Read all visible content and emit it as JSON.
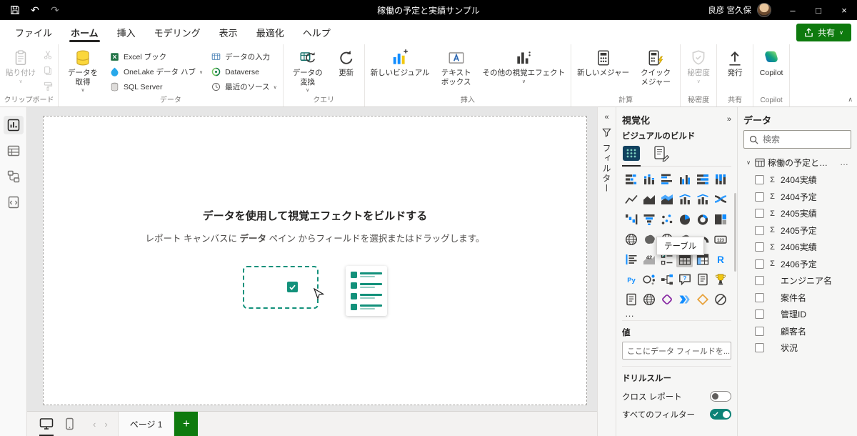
{
  "colors": {
    "accent_green": "#0e7a0e",
    "toggle_on": "#0c8276",
    "icon_blue": "#118DFF",
    "titlebar_bg": "#000000",
    "illustration_green": "#13917b"
  },
  "glyphs": {
    "chevron_down": "∨",
    "chevron_up": "∧",
    "chevron_left_double": "«",
    "chevron_right_double": "»",
    "undo": "↶",
    "redo": "↷",
    "minimize": "–",
    "maximize": "□",
    "close": "×",
    "more": "…",
    "ellipsis_row": "…",
    "page_prev": "‹",
    "page_next": "›",
    "sigma": "Σ",
    "plus": "+"
  },
  "titlebar": {
    "title": "稼働の予定と実績サンプル",
    "user_name": "良彦 宮久保"
  },
  "menubar": {
    "tabs": [
      {
        "name": "file",
        "label": "ファイル"
      },
      {
        "name": "home",
        "label": "ホーム"
      },
      {
        "name": "insert",
        "label": "挿入"
      },
      {
        "name": "modeling",
        "label": "モデリング"
      },
      {
        "name": "view",
        "label": "表示"
      },
      {
        "name": "optimize",
        "label": "最適化"
      },
      {
        "name": "help",
        "label": "ヘルプ"
      }
    ],
    "active_tab": "home",
    "share_label": "共有"
  },
  "ribbon": {
    "groups": [
      {
        "name": "clipboard",
        "label": "クリップボード",
        "bigs": [
          {
            "name": "paste",
            "label": "貼り付け",
            "icon": "clipboard",
            "disabled": true,
            "chevron": true,
            "wrap": true
          }
        ],
        "stack": [
          "cut",
          "copy",
          "format-painter"
        ]
      },
      {
        "name": "data",
        "label": "データ",
        "bigs": [
          {
            "name": "get-data",
            "label": "データを取得",
            "icon": "database",
            "chevron": true,
            "wrap": true
          }
        ],
        "cols": [
          [
            {
              "name": "excel-workbook",
              "label": "Excel ブック",
              "icon": "excel"
            },
            {
              "name": "onelake-data-hub",
              "label": "OneLake データ ハブ",
              "icon": "onelake",
              "chevron": true
            },
            {
              "name": "sql-server",
              "label": "SQL Server",
              "icon": "sql"
            }
          ],
          [
            {
              "name": "enter-data",
              "label": "データの入力",
              "icon": "enter-data"
            },
            {
              "name": "dataverse",
              "label": "Dataverse",
              "icon": "dataverse"
            },
            {
              "name": "recent-sources",
              "label": "最近のソース",
              "icon": "recent",
              "chevron": true
            }
          ]
        ]
      },
      {
        "name": "queries",
        "label": "クエリ",
        "bigs": [
          {
            "name": "transform-data",
            "label": "データの変換",
            "icon": "transform",
            "chevron": true,
            "wrap": true
          },
          {
            "name": "refresh",
            "label": "更新",
            "icon": "refresh"
          }
        ]
      },
      {
        "name": "insert",
        "label": "挿入",
        "bigs": [
          {
            "name": "new-visual",
            "label": "新しいビジュアル",
            "icon": "new-visual"
          },
          {
            "name": "text-box",
            "label": "テキスト ボックス",
            "icon": "text-box",
            "wrap": true
          },
          {
            "name": "more-visuals",
            "label": "その他の視覚エフェクト",
            "icon": "more-visuals",
            "chevron": true
          }
        ]
      },
      {
        "name": "calculations",
        "label": "計算",
        "bigs": [
          {
            "name": "new-measure",
            "label": "新しいメジャー",
            "icon": "new-measure"
          },
          {
            "name": "quick-measure",
            "label": "クイック メジャー",
            "icon": "quick-measure",
            "wrap": true
          }
        ]
      },
      {
        "name": "sensitivity",
        "label": "秘密度",
        "bigs": [
          {
            "name": "sensitivity",
            "label": "秘密度",
            "icon": "sensitivity",
            "disabled": true,
            "chevron": true
          }
        ]
      },
      {
        "name": "share",
        "label": "共有",
        "bigs": [
          {
            "name": "publish",
            "label": "発行",
            "icon": "publish"
          }
        ]
      },
      {
        "name": "copilot",
        "label": "Copilot",
        "bigs": [
          {
            "name": "copilot",
            "label": "Copilot",
            "icon": "copilot"
          }
        ]
      }
    ]
  },
  "view_sidebar": {
    "items": [
      {
        "name": "report-view",
        "active": true
      },
      {
        "name": "table-view",
        "active": false
      },
      {
        "name": "model-view",
        "active": false
      },
      {
        "name": "dax-query-view",
        "active": false
      }
    ]
  },
  "canvas": {
    "heading": "データを使用して視覚エフェクトをビルドする",
    "subtext_prefix": "レポート キャンバスに ",
    "subtext_bold": "データ",
    "subtext_suffix": " ペイン からフィールドを選択またはドラッグします。"
  },
  "filters_pane": {
    "title": "フィルター"
  },
  "visualizations_pane": {
    "title": "視覚化",
    "build_section_label": "ビジュアルのビルド",
    "tooltip": "テーブル",
    "values_label": "値",
    "field_well_placeholder": "ここにデータ フィールドを...",
    "drillthrough_label": "ドリルスルー",
    "cross_report_label": "クロス レポート",
    "cross_report_on": false,
    "keep_all_filters_label": "すべてのフィルター",
    "keep_all_filters_on": true,
    "visuals": [
      {
        "name": "stacked-bar-chart",
        "type": "hbar_s"
      },
      {
        "name": "stacked-column-chart",
        "type": "vbar_s"
      },
      {
        "name": "clustered-bar-chart",
        "type": "hbar_c"
      },
      {
        "name": "clustered-column-chart",
        "type": "vbar_c"
      },
      {
        "name": "100-stacked-bar-chart",
        "type": "hbar_f"
      },
      {
        "name": "100-stacked-column-chart",
        "type": "vbar_f"
      },
      {
        "name": "line-chart",
        "type": "line"
      },
      {
        "name": "area-chart",
        "type": "area"
      },
      {
        "name": "stacked-area-chart",
        "type": "area_s"
      },
      {
        "name": "line-and-stacked-column-chart",
        "type": "combo"
      },
      {
        "name": "line-and-clustered-column-chart",
        "type": "combo2"
      },
      {
        "name": "ribbon-chart",
        "type": "ribbon"
      },
      {
        "name": "waterfall-chart",
        "type": "waterfall"
      },
      {
        "name": "funnel-chart",
        "type": "funnel"
      },
      {
        "name": "scatter-chart",
        "type": "dots"
      },
      {
        "name": "pie-chart",
        "type": "pie"
      },
      {
        "name": "donut-chart",
        "type": "donut"
      },
      {
        "name": "treemap",
        "type": "treemap"
      },
      {
        "name": "map",
        "type": "globe"
      },
      {
        "name": "filled-map",
        "type": "blob"
      },
      {
        "name": "azure-map",
        "type": "globe2"
      },
      {
        "name": "shape-map",
        "type": "blob2"
      },
      {
        "name": "gauge",
        "type": "gauge"
      },
      {
        "name": "card",
        "type": "card123"
      },
      {
        "name": "multi-row-card",
        "type": "rows"
      },
      {
        "name": "kpi",
        "type": "kpi"
      },
      {
        "name": "slicer",
        "type": "slicer"
      },
      {
        "name": "table",
        "type": "grid",
        "highlighted": true
      },
      {
        "name": "matrix",
        "type": "matrix"
      },
      {
        "name": "r-script-visual",
        "type": "textR"
      },
      {
        "name": "python-visual",
        "type": "textPy"
      },
      {
        "name": "key-influencers",
        "type": "keyinf"
      },
      {
        "name": "decomposition-tree",
        "type": "tree"
      },
      {
        "name": "qa-visual",
        "type": "bubble"
      },
      {
        "name": "smart-narrative",
        "type": "doc"
      },
      {
        "name": "metrics",
        "type": "trophy"
      },
      {
        "name": "paginated-report",
        "type": "doc2"
      },
      {
        "name": "arcgis-map",
        "type": "globe"
      },
      {
        "name": "power-apps",
        "type": "papps"
      },
      {
        "name": "power-automate",
        "type": "pauto"
      },
      {
        "name": "custom-visual",
        "type": "diamond"
      },
      {
        "name": "get-more-visuals",
        "type": "slash"
      }
    ]
  },
  "data_pane": {
    "title": "データ",
    "search_placeholder": "検索",
    "table_name": "稼働の予定と実績",
    "fields": [
      {
        "name": "2404実績",
        "numeric": true
      },
      {
        "name": "2404予定",
        "numeric": true
      },
      {
        "name": "2405実績",
        "numeric": true
      },
      {
        "name": "2405予定",
        "numeric": true
      },
      {
        "name": "2406実績",
        "numeric": true
      },
      {
        "name": "2406予定",
        "numeric": true
      },
      {
        "name": "エンジニア名",
        "numeric": false
      },
      {
        "name": "案件名",
        "numeric": false
      },
      {
        "name": "管理ID",
        "numeric": false
      },
      {
        "name": "顧客名",
        "numeric": false
      },
      {
        "name": "状況",
        "numeric": false
      }
    ]
  },
  "bottombar": {
    "page_tab_label": "ページ 1"
  }
}
